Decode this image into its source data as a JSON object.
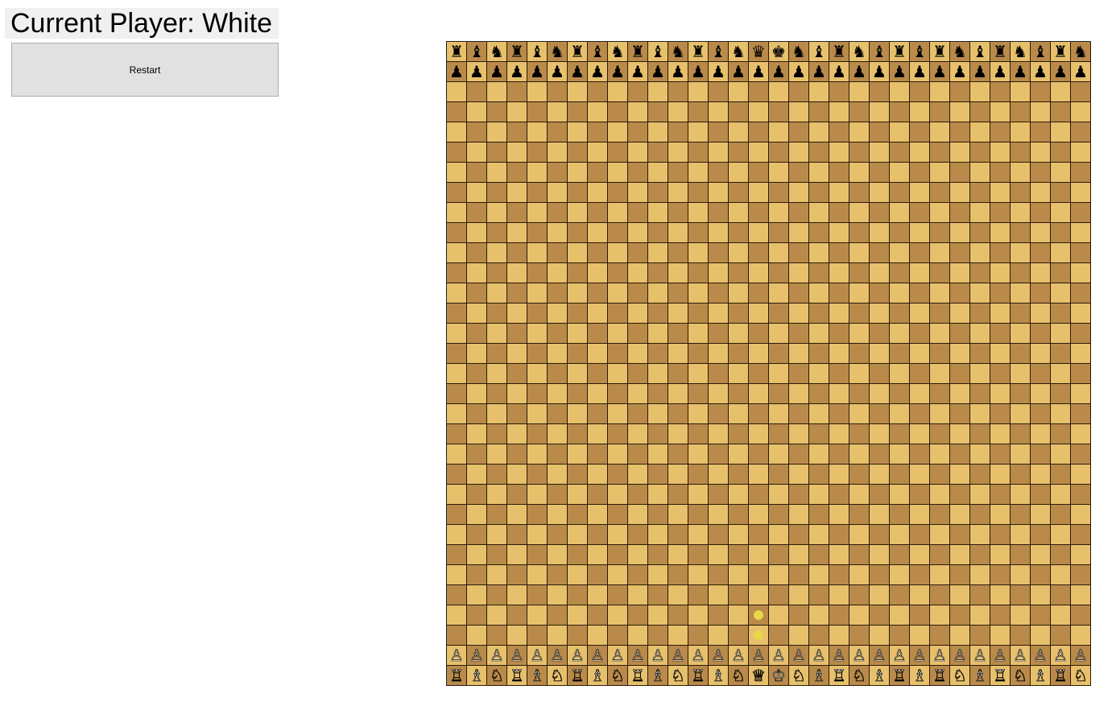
{
  "status": {
    "text": "Current Player: White"
  },
  "restart": {
    "label": "Restart"
  },
  "board": {
    "size": 32,
    "colors": {
      "light": "#e7c06c",
      "dark": "#b98a4a",
      "highlight": "#e8d64b"
    },
    "black_back_rank": "♜♝♞♜♝♞♜♝♞♜♝♞♜♝♞♛♚♞♝♜♞♝♜♝♜♞♝♜♞♝♜♞",
    "black_pawns": "♟♟♟♟♟♟♟♟♟♟♟♟♟♟♟♟♟♟♟♟♟♟♟♟♟♟♟♟♟♟♟♟",
    "white_pawns": "♙♙♙♙♙♙♙♙♙♙♙♙♙♙♙♙♙♙♙♙♙♙♙♙♙♙♙♙♙♙♙♙",
    "white_back_rank": "♖♗♘♖♗♘♖♗♘♖♗♘♖♗♘♕♔♘♗♖♘♗♖♗♖♘♗♖♘♗♖♘",
    "highlights": [
      {
        "row": 28,
        "col": 15
      },
      {
        "row": 29,
        "col": 15
      }
    ]
  }
}
